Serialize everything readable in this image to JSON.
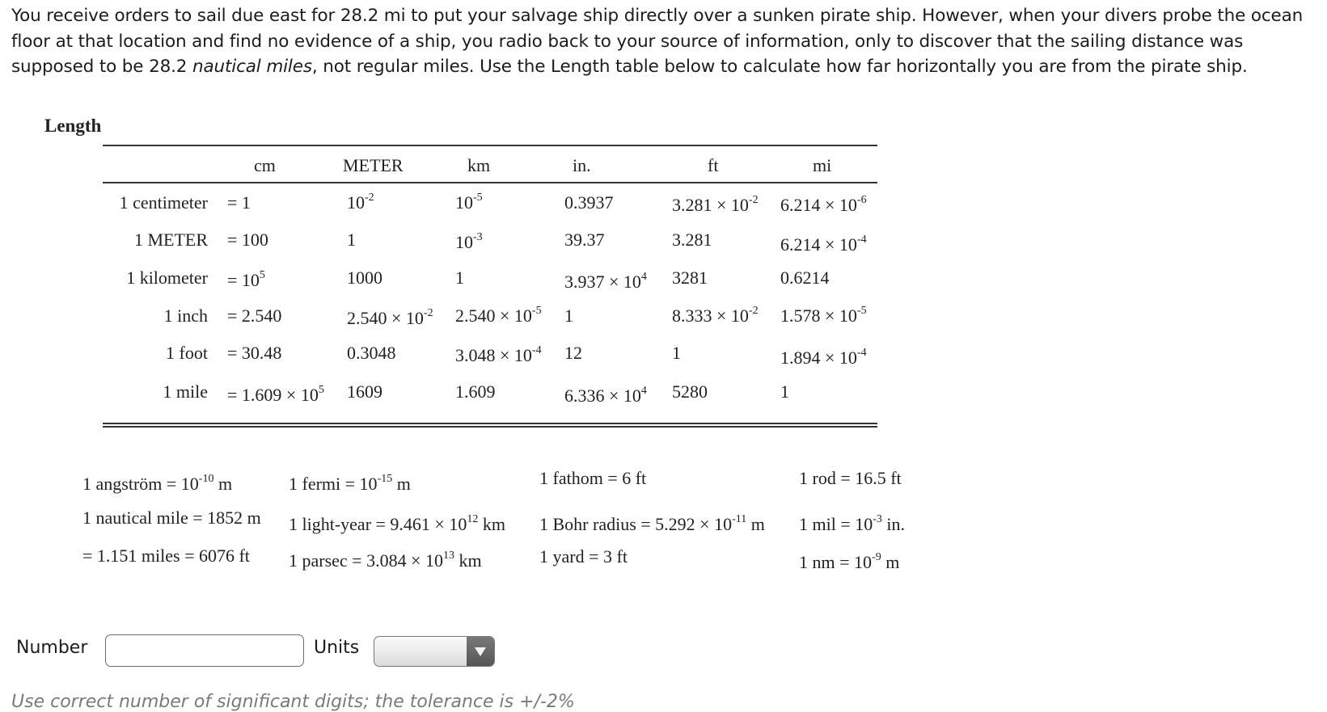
{
  "question": {
    "text_before": "You receive orders to sail due east for 28.2 mi to put your salvage ship directly over a sunken pirate ship. However, when your divers probe the ocean floor at that location and find no evidence of a ship, you radio back to your source of information, only to discover that the sailing distance was supposed to be 28.2 ",
    "emphasis": "nautical miles",
    "text_after": ", not regular miles. Use the Length table below to calculate how far horizontally you are from the pirate ship."
  },
  "table": {
    "title": "Length",
    "headers": [
      "cm",
      "METER",
      "km",
      "in.",
      "ft",
      "mi"
    ],
    "rows": [
      {
        "label": "1 centimeter",
        "cm": {
          "m": "= 1",
          "e": ""
        },
        "meter": {
          "m": "10",
          "e": "-2"
        },
        "km": {
          "m": "10",
          "e": "-5"
        },
        "in": {
          "m": "0.3937",
          "e": ""
        },
        "ft": {
          "m": "3.281 × 10",
          "e": "-2"
        },
        "mi": {
          "m": "6.214 × 10",
          "e": "-6"
        }
      },
      {
        "label": "1 METER",
        "cm": {
          "m": "= 100",
          "e": ""
        },
        "meter": {
          "m": "1",
          "e": ""
        },
        "km": {
          "m": "10",
          "e": "-3"
        },
        "in": {
          "m": "39.37",
          "e": ""
        },
        "ft": {
          "m": "3.281",
          "e": ""
        },
        "mi": {
          "m": "6.214 × 10",
          "e": "-4"
        }
      },
      {
        "label": "1 kilometer",
        "cm": {
          "m": "= 10",
          "e": "5"
        },
        "meter": {
          "m": "1000",
          "e": ""
        },
        "km": {
          "m": "1",
          "e": ""
        },
        "in": {
          "m": "3.937 × 10",
          "e": "4"
        },
        "ft": {
          "m": "3281",
          "e": ""
        },
        "mi": {
          "m": "0.6214",
          "e": ""
        }
      },
      {
        "label": "1 inch",
        "cm": {
          "m": "= 2.540",
          "e": ""
        },
        "meter": {
          "m": "2.540 × 10",
          "e": "-2"
        },
        "km": {
          "m": "2.540 × 10",
          "e": "-5"
        },
        "in": {
          "m": "1",
          "e": ""
        },
        "ft": {
          "m": "8.333 × 10",
          "e": "-2"
        },
        "mi": {
          "m": "1.578 × 10",
          "e": "-5"
        }
      },
      {
        "label": "1 foot",
        "cm": {
          "m": "= 30.48",
          "e": ""
        },
        "meter": {
          "m": "0.3048",
          "e": ""
        },
        "km": {
          "m": "3.048 × 10",
          "e": "-4"
        },
        "in": {
          "m": "12",
          "e": ""
        },
        "ft": {
          "m": "1",
          "e": ""
        },
        "mi": {
          "m": "1.894 × 10",
          "e": "-4"
        }
      },
      {
        "label": "1 mile",
        "cm": {
          "m": "= 1.609 × 10",
          "e": "5"
        },
        "meter": {
          "m": "1609",
          "e": ""
        },
        "km": {
          "m": "1.609",
          "e": ""
        },
        "in": {
          "m": "6.336 × 10",
          "e": "4"
        },
        "ft": {
          "m": "5280",
          "e": ""
        },
        "mi": {
          "m": "1",
          "e": ""
        }
      }
    ]
  },
  "extras": [
    {
      "pre": "1 angström = 10",
      "e": "-10",
      "post": " m"
    },
    {
      "pre": "1 nautical mile = 1852 m",
      "e": "",
      "post": ""
    },
    {
      "pre": "= 1.151 miles = 6076 ft",
      "e": "",
      "post": ""
    },
    {
      "pre": "1 fermi = 10",
      "e": "-15",
      "post": " m"
    },
    {
      "pre": "1 light-year = 9.461 × 10",
      "e": "12",
      "post": " km"
    },
    {
      "pre": "1 parsec = 3.084 × 10",
      "e": "13",
      "post": " km"
    },
    {
      "pre": "1 fathom = 6 ft",
      "e": "",
      "post": ""
    },
    {
      "pre": "1 Bohr radius = 5.292 × 10",
      "e": "-11",
      "post": " m"
    },
    {
      "pre": "1 yard = 3 ft",
      "e": "",
      "post": ""
    },
    {
      "pre": "1 rod = 16.5 ft",
      "e": "",
      "post": ""
    },
    {
      "pre": "1 mil = 10",
      "e": "-3",
      "post": " in."
    },
    {
      "pre": "1 nm = 10",
      "e": "-9",
      "post": " m"
    }
  ],
  "form": {
    "number_label": "Number",
    "number_value": "",
    "units_label": "Units",
    "units_value": "",
    "hint": "Use correct number of significant digits; the tolerance is +/-2%"
  }
}
